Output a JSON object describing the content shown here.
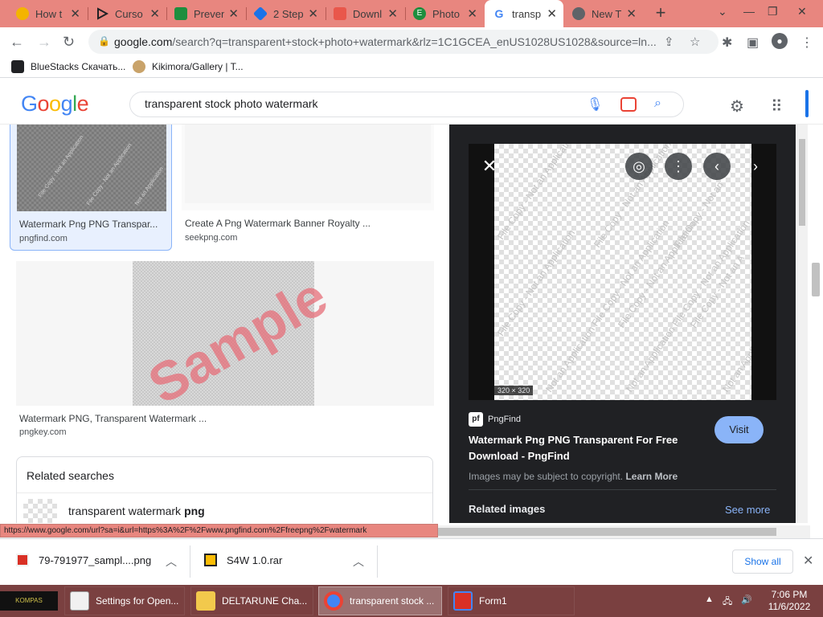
{
  "browser": {
    "tabs": [
      {
        "label": "How t",
        "icon": "emoji-face-icon",
        "color": "#f4b400"
      },
      {
        "label": "Curso",
        "icon": "cursor-triangle-icon",
        "color": "#202124"
      },
      {
        "label": "Preven",
        "icon": "person-green-icon",
        "color": "#1e8e3e"
      },
      {
        "label": "2 Step",
        "icon": "diamond-blue-icon",
        "color": "#1a73e8"
      },
      {
        "label": "Downl",
        "icon": "folder-red-icon",
        "color": "#ea4335"
      },
      {
        "label": "Photo",
        "icon": "e-logo-icon",
        "color": "#1e8e3e"
      },
      {
        "label": "transp",
        "icon": "google-g-icon",
        "color": "#4285f4",
        "active": true
      },
      {
        "label": "New T",
        "icon": "chrome-icon",
        "color": "#5f6368"
      }
    ],
    "new_tab": "+",
    "url_host": "google.com",
    "url_rest": "/search?q=transparent+stock+photo+watermark&rlz=1C1GCEA_enUS1028US1028&source=ln...",
    "bookmarks": [
      {
        "label": "BlueStacks Скачать...",
        "icon": "bluestacks-icon"
      },
      {
        "label": "Kikimora/Gallery | T...",
        "icon": "kikimora-icon"
      }
    ]
  },
  "google": {
    "logo_letters": [
      {
        "ch": "G",
        "color": "#4285f4"
      },
      {
        "ch": "o",
        "color": "#ea4335"
      },
      {
        "ch": "o",
        "color": "#fbbc05"
      },
      {
        "ch": "g",
        "color": "#4285f4"
      },
      {
        "ch": "l",
        "color": "#34a853"
      },
      {
        "ch": "e",
        "color": "#ea4335"
      }
    ],
    "query": "transparent stock photo watermark"
  },
  "results": [
    {
      "title": "Watermark Png PNG Transpar...",
      "source": "pngfind.com",
      "selected": true
    },
    {
      "title": "Create A Png Watermark Banner Royalty ...",
      "source": "seekpng.com"
    },
    {
      "title": "Watermark PNG, Transparent Watermark ...",
      "source": "pngkey.com",
      "overlay": "Sample"
    }
  ],
  "related": {
    "title": "Related searches",
    "item_prefix": "transparent watermark ",
    "item_bold": "png"
  },
  "preview": {
    "watermark_text": "File Copy - Not an Application",
    "dimensions": "320 × 320",
    "source_badge": "pf",
    "source_name": "PngFind",
    "title": "Watermark Png PNG Transparent For Free Download - PngFind",
    "visit": "Visit",
    "copyright": "Images may be subject to copyright.",
    "learn_more": "Learn More",
    "related_images": "Related images",
    "see_more": "See more"
  },
  "status_url": "https://www.google.com/url?sa=i&url=https%3A%2F%2Fwww.pngfind.com%2Ffreepng%2Fwatermark",
  "downloads": {
    "items": [
      {
        "name": "79-791977_sampl....png",
        "icon": "png-file-icon"
      },
      {
        "name": "S4W 1.0.rar",
        "icon": "rar-file-icon"
      }
    ],
    "show_all": "Show all"
  },
  "taskbar": {
    "start_label": "KOMPAS",
    "items": [
      {
        "label": "Settings for Open...",
        "icon": "document-icon",
        "color": "#f1f1f1"
      },
      {
        "label": "DELTARUNE Cha...",
        "icon": "folder-icon",
        "color": "#f2c94c"
      },
      {
        "label": "transparent stock ...",
        "icon": "chrome-icon",
        "color": "#4285f4",
        "active": true
      },
      {
        "label": "Form1",
        "icon": "form-icon",
        "color": "#d93025"
      }
    ],
    "time": "7:06 PM",
    "date": "11/6/2022"
  }
}
